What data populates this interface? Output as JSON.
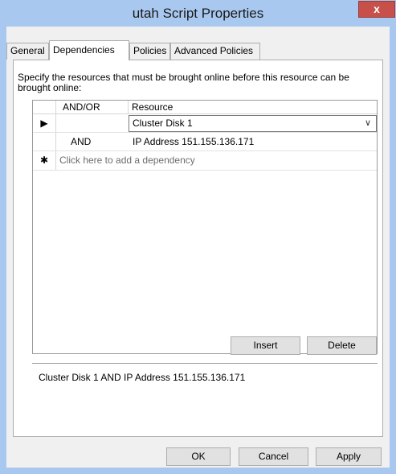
{
  "window": {
    "title": "utah Script Properties",
    "close_label": "x"
  },
  "tabs": [
    {
      "label": "General",
      "active": false
    },
    {
      "label": "Dependencies",
      "active": true
    },
    {
      "label": "Policies",
      "active": false
    },
    {
      "label": "Advanced Policies",
      "active": false
    }
  ],
  "dependencies": {
    "instruction": "Specify the resources that must be brought online before this resource can be brought online:",
    "columns": {
      "andor": "AND/OR",
      "resource": "Resource"
    },
    "rows": [
      {
        "selector": "▶",
        "andor": "",
        "resource": "Cluster Disk 1",
        "editing": true
      },
      {
        "selector": "",
        "andor": "AND",
        "resource": "IP Address 151.155.136.171",
        "editing": false
      }
    ],
    "new_row": {
      "selector": "✱",
      "placeholder": "Click here to add a dependency"
    },
    "combo_arrow": "∨",
    "insert_label": "Insert",
    "delete_label": "Delete",
    "summary": "Cluster Disk 1 AND IP Address 151.155.136.171"
  },
  "buttons": {
    "ok": "OK",
    "cancel": "Cancel",
    "apply": "Apply"
  }
}
